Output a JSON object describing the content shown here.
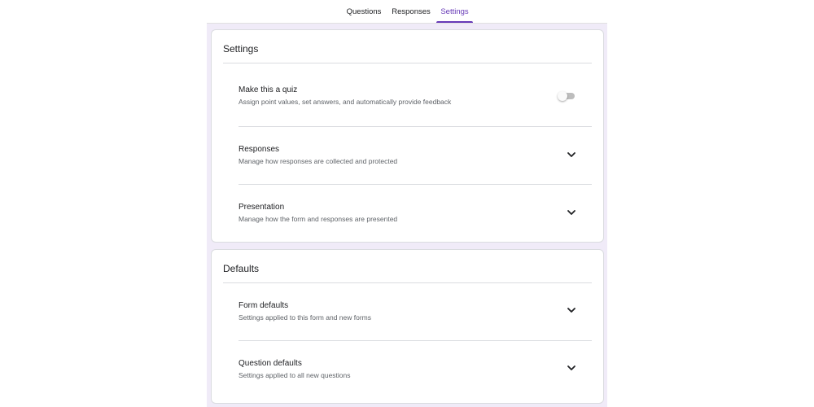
{
  "tabs": [
    {
      "label": "Questions"
    },
    {
      "label": "Responses"
    },
    {
      "label": "Settings",
      "active": true
    }
  ],
  "colors": {
    "accent": "#673ab7",
    "canvas_background": "#f0ebf8",
    "toggle_off_track": "#bdbdbd"
  },
  "settings": {
    "title": "Settings",
    "quiz": {
      "title": "Make this a quiz",
      "subtitle": "Assign point values, set answers, and automatically provide feedback",
      "toggle_state": "off"
    },
    "responses": {
      "title": "Responses",
      "subtitle": "Manage how responses are collected and protected",
      "icon": "chevron-down-icon"
    },
    "presentation": {
      "title": "Presentation",
      "subtitle": "Manage how the form and responses are presented",
      "icon": "chevron-down-icon"
    }
  },
  "defaults": {
    "title": "Defaults",
    "form_defaults": {
      "title": "Form defaults",
      "subtitle": "Settings applied to this form and new forms",
      "icon": "chevron-down-icon"
    },
    "question_defaults": {
      "title": "Question defaults",
      "subtitle": "Settings applied to all new questions",
      "icon": "chevron-down-icon"
    }
  }
}
